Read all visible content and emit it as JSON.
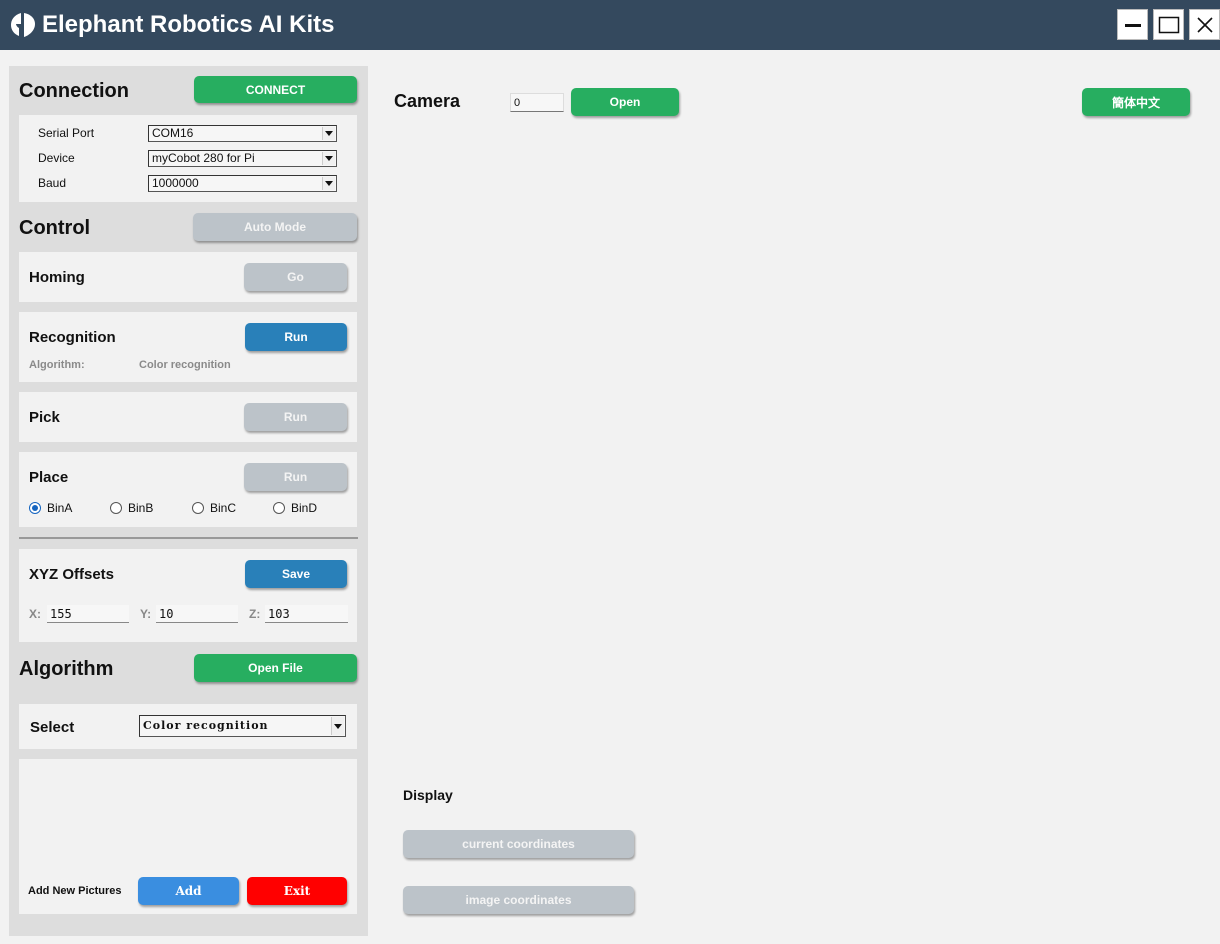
{
  "app": {
    "title": "Elephant Robotics AI Kits"
  },
  "connection": {
    "title": "Connection",
    "connect_label": "CONNECT",
    "serial_port_label": "Serial Port",
    "serial_port_value": "COM16",
    "device_label": "Device",
    "device_value": "myCobot 280 for Pi",
    "baud_label": "Baud",
    "baud_value": "1000000"
  },
  "control": {
    "title": "Control",
    "auto_mode_label": "Auto Mode",
    "homing": {
      "title": "Homing",
      "button": "Go"
    },
    "recognition": {
      "title": "Recognition",
      "button": "Run",
      "algorithm_label": "Algorithm:",
      "algorithm_value": "Color recognition"
    },
    "pick": {
      "title": "Pick",
      "button": "Run"
    },
    "place": {
      "title": "Place",
      "button": "Run",
      "bins": [
        "BinA",
        "BinB",
        "BinC",
        "BinD"
      ],
      "selected_bin": "BinA"
    }
  },
  "offsets": {
    "title": "XYZ Offsets",
    "save_label": "Save",
    "x_label": "X:",
    "x_value": "155",
    "y_label": "Y:",
    "y_value": "10",
    "z_label": "Z:",
    "z_value": "103"
  },
  "algorithm": {
    "title": "Algorithm",
    "open_file_label": "Open File",
    "select_label": "Select",
    "select_value": "Color recognition",
    "add_pictures_label": "Add New Pictures",
    "add_label": "Add",
    "exit_label": "Exit"
  },
  "camera": {
    "title": "Camera",
    "index_value": "0",
    "open_label": "Open"
  },
  "language_button": "簡体中文",
  "display": {
    "title": "Display",
    "current_coords_label": "current coordinates",
    "image_coords_label": "image coordinates"
  },
  "colors": {
    "titlebar": "#34495e",
    "green": "#27ae60",
    "blue": "#2980b9",
    "gray": "#bcc3c9",
    "red": "#ff0000",
    "light_blue": "#3a8ee0"
  }
}
